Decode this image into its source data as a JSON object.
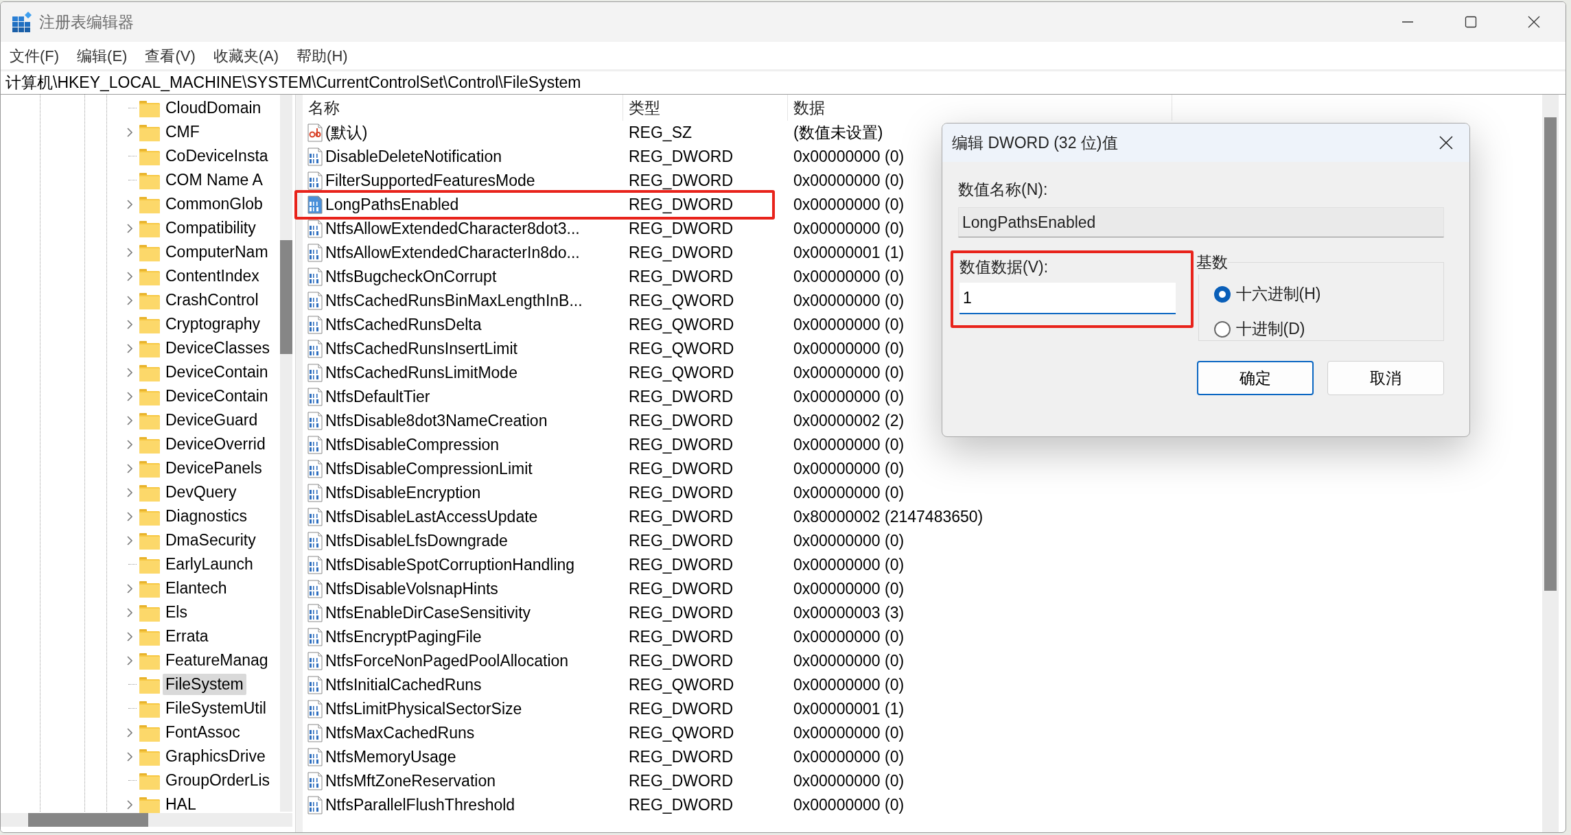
{
  "window": {
    "title": "注册表编辑器"
  },
  "menu": [
    "文件(F)",
    "编辑(E)",
    "查看(V)",
    "收藏夹(A)",
    "帮助(H)"
  ],
  "address": "计算机\\HKEY_LOCAL_MACHINE\\SYSTEM\\CurrentControlSet\\Control\\FileSystem",
  "tree": {
    "items": [
      {
        "label": "CloudDomain",
        "expandable": false,
        "selected": false
      },
      {
        "label": "CMF",
        "expandable": true,
        "selected": false
      },
      {
        "label": "CoDeviceInsta",
        "expandable": false,
        "selected": false
      },
      {
        "label": "COM Name A",
        "expandable": false,
        "selected": false
      },
      {
        "label": "CommonGlob",
        "expandable": true,
        "selected": false
      },
      {
        "label": "Compatibility",
        "expandable": true,
        "selected": false
      },
      {
        "label": "ComputerNam",
        "expandable": true,
        "selected": false
      },
      {
        "label": "ContentIndex",
        "expandable": true,
        "selected": false
      },
      {
        "label": "CrashControl",
        "expandable": true,
        "selected": false
      },
      {
        "label": "Cryptography",
        "expandable": true,
        "selected": false
      },
      {
        "label": "DeviceClasses",
        "expandable": true,
        "selected": false
      },
      {
        "label": "DeviceContain",
        "expandable": true,
        "selected": false
      },
      {
        "label": "DeviceContain",
        "expandable": true,
        "selected": false
      },
      {
        "label": "DeviceGuard",
        "expandable": true,
        "selected": false
      },
      {
        "label": "DeviceOverrid",
        "expandable": true,
        "selected": false
      },
      {
        "label": "DevicePanels",
        "expandable": true,
        "selected": false
      },
      {
        "label": "DevQuery",
        "expandable": true,
        "selected": false
      },
      {
        "label": "Diagnostics",
        "expandable": true,
        "selected": false
      },
      {
        "label": "DmaSecurity",
        "expandable": true,
        "selected": false
      },
      {
        "label": "EarlyLaunch",
        "expandable": false,
        "selected": false
      },
      {
        "label": "Elantech",
        "expandable": true,
        "selected": false
      },
      {
        "label": "Els",
        "expandable": true,
        "selected": false
      },
      {
        "label": "Errata",
        "expandable": true,
        "selected": false
      },
      {
        "label": "FeatureManag",
        "expandable": true,
        "selected": false
      },
      {
        "label": "FileSystem",
        "expandable": false,
        "selected": true
      },
      {
        "label": "FileSystemUtil",
        "expandable": false,
        "selected": false
      },
      {
        "label": "FontAssoc",
        "expandable": true,
        "selected": false
      },
      {
        "label": "GraphicsDrive",
        "expandable": true,
        "selected": false
      },
      {
        "label": "GroupOrderLis",
        "expandable": false,
        "selected": false
      },
      {
        "label": "HAL",
        "expandable": true,
        "selected": false
      }
    ]
  },
  "values": {
    "columns": [
      "名称",
      "类型",
      "数据"
    ],
    "rows": [
      {
        "kind": "string",
        "name": "(默认)",
        "type": "REG_SZ",
        "data": "(数值未设置)",
        "selected": false,
        "highlighted": false
      },
      {
        "kind": "binary",
        "name": "DisableDeleteNotification",
        "type": "REG_DWORD",
        "data": "0x00000000 (0)",
        "selected": false,
        "highlighted": false
      },
      {
        "kind": "binary",
        "name": "FilterSupportedFeaturesMode",
        "type": "REG_DWORD",
        "data": "0x00000000 (0)",
        "selected": false,
        "highlighted": false
      },
      {
        "kind": "binary",
        "name": "LongPathsEnabled",
        "type": "REG_DWORD",
        "data": "0x00000000 (0)",
        "selected": true,
        "highlighted": true
      },
      {
        "kind": "binary",
        "name": "NtfsAllowExtendedCharacter8dot3...",
        "type": "REG_DWORD",
        "data": "0x00000000 (0)",
        "selected": false,
        "highlighted": false
      },
      {
        "kind": "binary",
        "name": "NtfsAllowExtendedCharacterIn8do...",
        "type": "REG_DWORD",
        "data": "0x00000001 (1)",
        "selected": false,
        "highlighted": false
      },
      {
        "kind": "binary",
        "name": "NtfsBugcheckOnCorrupt",
        "type": "REG_DWORD",
        "data": "0x00000000 (0)",
        "selected": false,
        "highlighted": false
      },
      {
        "kind": "binary",
        "name": "NtfsCachedRunsBinMaxLengthInB...",
        "type": "REG_QWORD",
        "data": "0x00000000 (0)",
        "selected": false,
        "highlighted": false
      },
      {
        "kind": "binary",
        "name": "NtfsCachedRunsDelta",
        "type": "REG_QWORD",
        "data": "0x00000000 (0)",
        "selected": false,
        "highlighted": false
      },
      {
        "kind": "binary",
        "name": "NtfsCachedRunsInsertLimit",
        "type": "REG_QWORD",
        "data": "0x00000000 (0)",
        "selected": false,
        "highlighted": false
      },
      {
        "kind": "binary",
        "name": "NtfsCachedRunsLimitMode",
        "type": "REG_QWORD",
        "data": "0x00000000 (0)",
        "selected": false,
        "highlighted": false
      },
      {
        "kind": "binary",
        "name": "NtfsDefaultTier",
        "type": "REG_DWORD",
        "data": "0x00000000 (0)",
        "selected": false,
        "highlighted": false
      },
      {
        "kind": "binary",
        "name": "NtfsDisable8dot3NameCreation",
        "type": "REG_DWORD",
        "data": "0x00000002 (2)",
        "selected": false,
        "highlighted": false
      },
      {
        "kind": "binary",
        "name": "NtfsDisableCompression",
        "type": "REG_DWORD",
        "data": "0x00000000 (0)",
        "selected": false,
        "highlighted": false
      },
      {
        "kind": "binary",
        "name": "NtfsDisableCompressionLimit",
        "type": "REG_DWORD",
        "data": "0x00000000 (0)",
        "selected": false,
        "highlighted": false
      },
      {
        "kind": "binary",
        "name": "NtfsDisableEncryption",
        "type": "REG_DWORD",
        "data": "0x00000000 (0)",
        "selected": false,
        "highlighted": false
      },
      {
        "kind": "binary",
        "name": "NtfsDisableLastAccessUpdate",
        "type": "REG_DWORD",
        "data": "0x80000002 (2147483650)",
        "selected": false,
        "highlighted": false
      },
      {
        "kind": "binary",
        "name": "NtfsDisableLfsDowngrade",
        "type": "REG_DWORD",
        "data": "0x00000000 (0)",
        "selected": false,
        "highlighted": false
      },
      {
        "kind": "binary",
        "name": "NtfsDisableSpotCorruptionHandling",
        "type": "REG_DWORD",
        "data": "0x00000000 (0)",
        "selected": false,
        "highlighted": false
      },
      {
        "kind": "binary",
        "name": "NtfsDisableVolsnapHints",
        "type": "REG_DWORD",
        "data": "0x00000000 (0)",
        "selected": false,
        "highlighted": false
      },
      {
        "kind": "binary",
        "name": "NtfsEnableDirCaseSensitivity",
        "type": "REG_DWORD",
        "data": "0x00000003 (3)",
        "selected": false,
        "highlighted": false
      },
      {
        "kind": "binary",
        "name": "NtfsEncryptPagingFile",
        "type": "REG_DWORD",
        "data": "0x00000000 (0)",
        "selected": false,
        "highlighted": false
      },
      {
        "kind": "binary",
        "name": "NtfsForceNonPagedPoolAllocation",
        "type": "REG_DWORD",
        "data": "0x00000000 (0)",
        "selected": false,
        "highlighted": false
      },
      {
        "kind": "binary",
        "name": "NtfsInitialCachedRuns",
        "type": "REG_QWORD",
        "data": "0x00000000 (0)",
        "selected": false,
        "highlighted": false
      },
      {
        "kind": "binary",
        "name": "NtfsLimitPhysicalSectorSize",
        "type": "REG_DWORD",
        "data": "0x00000001 (1)",
        "selected": false,
        "highlighted": false
      },
      {
        "kind": "binary",
        "name": "NtfsMaxCachedRuns",
        "type": "REG_QWORD",
        "data": "0x00000000 (0)",
        "selected": false,
        "highlighted": false
      },
      {
        "kind": "binary",
        "name": "NtfsMemoryUsage",
        "type": "REG_DWORD",
        "data": "0x00000000 (0)",
        "selected": false,
        "highlighted": false
      },
      {
        "kind": "binary",
        "name": "NtfsMftZoneReservation",
        "type": "REG_DWORD",
        "data": "0x00000000 (0)",
        "selected": false,
        "highlighted": false
      },
      {
        "kind": "binary",
        "name": "NtfsParallelFlushThreshold",
        "type": "REG_DWORD",
        "data": "0x00000000 (0)",
        "selected": false,
        "highlighted": false
      }
    ]
  },
  "dialog": {
    "title": "编辑 DWORD (32 位)值",
    "name_label": "数值名称(N):",
    "name_value": "LongPathsEnabled",
    "data_label": "数值数据(V):",
    "data_value": "1",
    "data_highlighted": true,
    "base_label": "基数",
    "radios": [
      {
        "label": "十六进制(H)",
        "selected": true
      },
      {
        "label": "十进制(D)",
        "selected": false
      }
    ],
    "buttons": [
      {
        "label": "确定",
        "default": true
      },
      {
        "label": "取消",
        "default": false
      }
    ]
  }
}
